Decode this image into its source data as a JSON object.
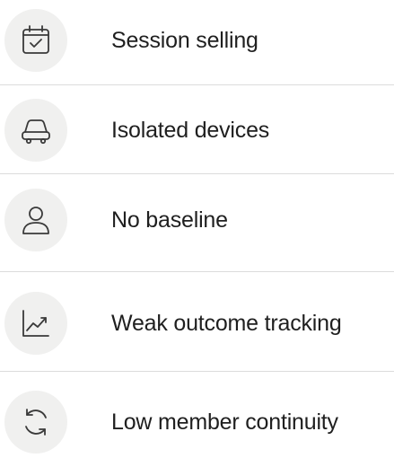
{
  "items": [
    {
      "label": "Session selling",
      "icon": "calendar-check-icon"
    },
    {
      "label": "Isolated devices",
      "icon": "car-icon"
    },
    {
      "label": "No baseline",
      "icon": "user-icon"
    },
    {
      "label": "Weak outcome tracking",
      "icon": "line-chart-icon"
    },
    {
      "label": "Low member continuity",
      "icon": "refresh-icon"
    }
  ],
  "colors": {
    "icon_bg": "#f0f0ef",
    "icon_stroke": "#3a3a3a",
    "divider": "#dcdcdc",
    "text": "#1f1f1f"
  }
}
